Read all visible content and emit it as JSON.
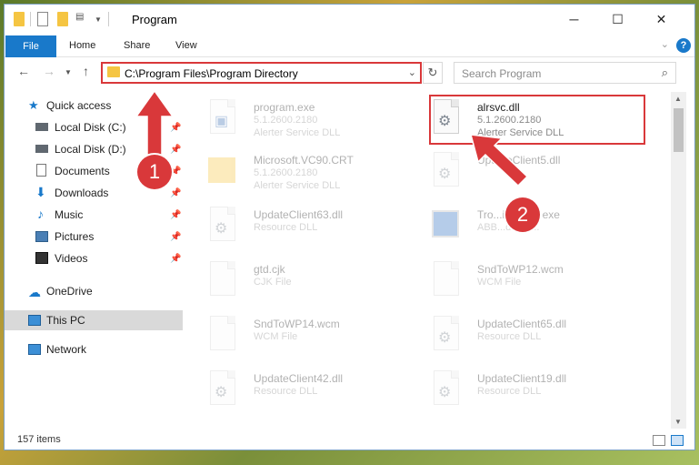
{
  "window": {
    "title": "Program"
  },
  "ribbon": {
    "tabs": [
      "File",
      "Home",
      "Share",
      "View"
    ],
    "help": "?"
  },
  "address": {
    "path": "C:\\Program Files\\Program Directory"
  },
  "search": {
    "placeholder": "Search Program"
  },
  "sidebar": {
    "quick_access": "Quick access",
    "items": [
      {
        "label": "Local Disk (C:)",
        "icon": "drive-icon"
      },
      {
        "label": "Local Disk (D:)",
        "icon": "drive-icon"
      },
      {
        "label": "Documents",
        "icon": "documents-icon"
      },
      {
        "label": "Downloads",
        "icon": "downloads-icon"
      },
      {
        "label": "Music",
        "icon": "music-icon"
      },
      {
        "label": "Pictures",
        "icon": "pictures-icon"
      },
      {
        "label": "Videos",
        "icon": "videos-icon"
      }
    ],
    "onedrive": "OneDrive",
    "thispc": "This PC",
    "network": "Network"
  },
  "files": [
    {
      "name": "program.exe",
      "meta1": "5.1.2600.2180",
      "meta2": "Alerter Service DLL"
    },
    {
      "name": "alrsvc.dll",
      "meta1": "5.1.2600.2180",
      "meta2": "Alerter Service DLL"
    },
    {
      "name": "Microsoft.VC90.CRT",
      "meta1": "5.1.2600.2180",
      "meta2": "Alerter Service DLL"
    },
    {
      "name": "UpdateClient5.dll",
      "meta1": "",
      "meta2": ""
    },
    {
      "name": "UpdateClient63.dll",
      "meta1": "Resource DLL",
      "meta2": ""
    },
    {
      "name": "Tro...installer.exe",
      "meta1": "ABB...der tri...",
      "meta2": ""
    },
    {
      "name": "gtd.cjk",
      "meta1": "CJK File",
      "meta2": ""
    },
    {
      "name": "SndToWP12.wcm",
      "meta1": "WCM File",
      "meta2": ""
    },
    {
      "name": "SndToWP14.wcm",
      "meta1": "WCM File",
      "meta2": ""
    },
    {
      "name": "UpdateClient65.dll",
      "meta1": "Resource DLL",
      "meta2": ""
    },
    {
      "name": "UpdateClient42.dll",
      "meta1": "Resource DLL",
      "meta2": ""
    },
    {
      "name": "UpdateClient19.dll",
      "meta1": "Resource DLL",
      "meta2": ""
    }
  ],
  "status": {
    "count": "157 items"
  },
  "annotations": {
    "step1": "1",
    "step2": "2"
  },
  "colors": {
    "accent": "#1979ca",
    "highlight": "#d9383a"
  }
}
